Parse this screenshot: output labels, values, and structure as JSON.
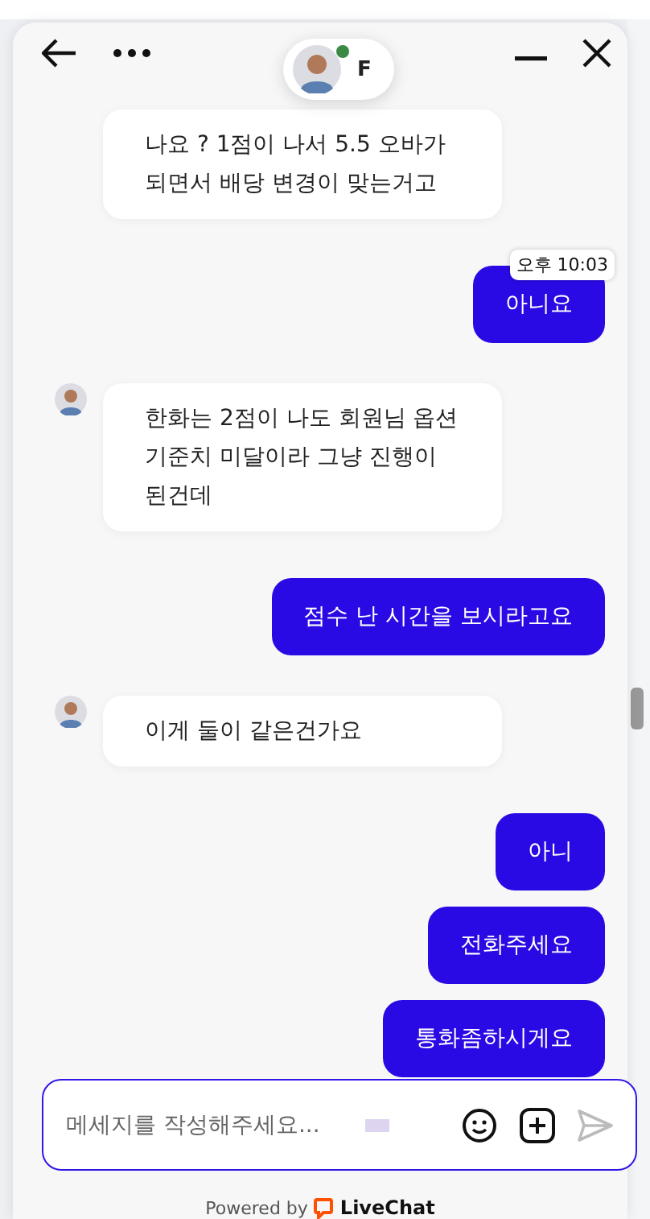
{
  "header": {
    "agent_initial": "F",
    "agent_online": true
  },
  "messages": [
    {
      "kind": "agent",
      "avatar": false,
      "text": "나요 ? 1점이 나서 5.5 오바가 되면서 배당 변경이 맞는거고"
    },
    {
      "kind": "visitor",
      "text": "아니요",
      "time": "오후 10:03"
    },
    {
      "kind": "agent",
      "avatar": true,
      "text": "한화는 2점이 나도 회원님 옵션 기준치 미달이라 그냥 진행이 된건데"
    },
    {
      "kind": "visitor",
      "text": "점수 난 시간을 보시라고요"
    },
    {
      "kind": "agent",
      "avatar": true,
      "text": "이게 둘이 같은건가요"
    },
    {
      "kind": "visitor",
      "text": "아니"
    },
    {
      "kind": "visitor",
      "text": "전화주세요"
    },
    {
      "kind": "visitor",
      "text": "통화좀하시게요"
    }
  ],
  "composer": {
    "placeholder": "메세지를 작성해주세요..."
  },
  "footer": {
    "powered_by": "Powered by",
    "brand": "LiveChat"
  }
}
